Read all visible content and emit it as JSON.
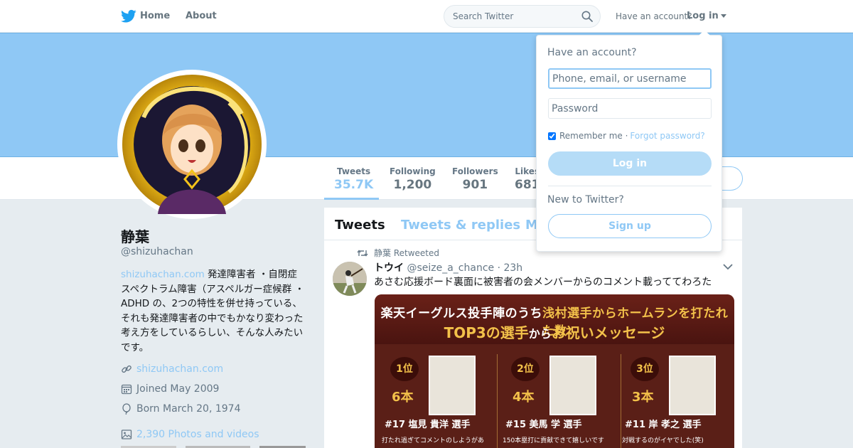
{
  "nav": {
    "home": "Home",
    "about": "About",
    "search_placeholder": "Search Twitter",
    "have_account": "Have an account?",
    "login": "Log in"
  },
  "stats": [
    {
      "label": "Tweets",
      "value": "35.7K"
    },
    {
      "label": "Following",
      "value": "1,200"
    },
    {
      "label": "Followers",
      "value": "901"
    },
    {
      "label": "Likes",
      "value": "681"
    }
  ],
  "profile": {
    "name": "静葉",
    "handle": "@shizuhachan",
    "bio_link": "shizuhachan.com",
    "bio_text": " 発達障害者 ・自閉症スペクトラム障害（アスペルガー症候群 ・ADHD の、2つの特性を併せ持っている、それも発達障害者の中でもかなり変わった考え方をしているらしい、そんな人みたいです。",
    "website": "shizuhachan.com",
    "joined": "Joined May 2009",
    "born": "Born March 20, 1974",
    "photos": "2,390 Photos and videos"
  },
  "timeline": {
    "tabs": [
      "Tweets",
      "Tweets & replies",
      "M"
    ],
    "tweet": {
      "retweeted_by": "静葉 Retweeted",
      "author_name": "トウイ",
      "author_handle": "@seize_a_chance",
      "time": "· 23h",
      "text": "あさむ応援ボード裏面に被害者の会メンバーからのコメント載っててわろた",
      "image": {
        "line1_a": "楽天イーグルス投手陣のうち",
        "line1_b": "浅村選手からホームランを打たれた数",
        "line2_a": "TOP3の選手",
        "line2_b": "から",
        "line2_c": "お祝いメッセージ",
        "ranks": [
          {
            "badge": "1位",
            "hr": "6本",
            "num": "#17 塩見 貴洋 選手",
            "msg": "打たれ過ぎてコメントのしようがあ"
          },
          {
            "badge": "2位",
            "hr": "4本",
            "num": "#15 美馬 学 選手",
            "msg": "150本塁打に貢献できて嬉しいです"
          },
          {
            "badge": "3位",
            "hr": "3本",
            "num": "#11 岸 孝之 選手",
            "msg": "対戦するのがイヤでした(笑)"
          }
        ]
      }
    }
  },
  "login_dropdown": {
    "title": "Have an account?",
    "username_placeholder": "Phone, email, or username",
    "password_placeholder": "Password",
    "remember_me": "Remember me ·",
    "forgot": "Forgot password?",
    "login_button": "Log in",
    "new_to_twitter": "New to Twitter?",
    "signup_button": "Sign up"
  },
  "colors": {
    "accent": "#8fc8f5",
    "banner": "#8fc8f5",
    "text": "#14171a",
    "secondary": "#657786"
  }
}
